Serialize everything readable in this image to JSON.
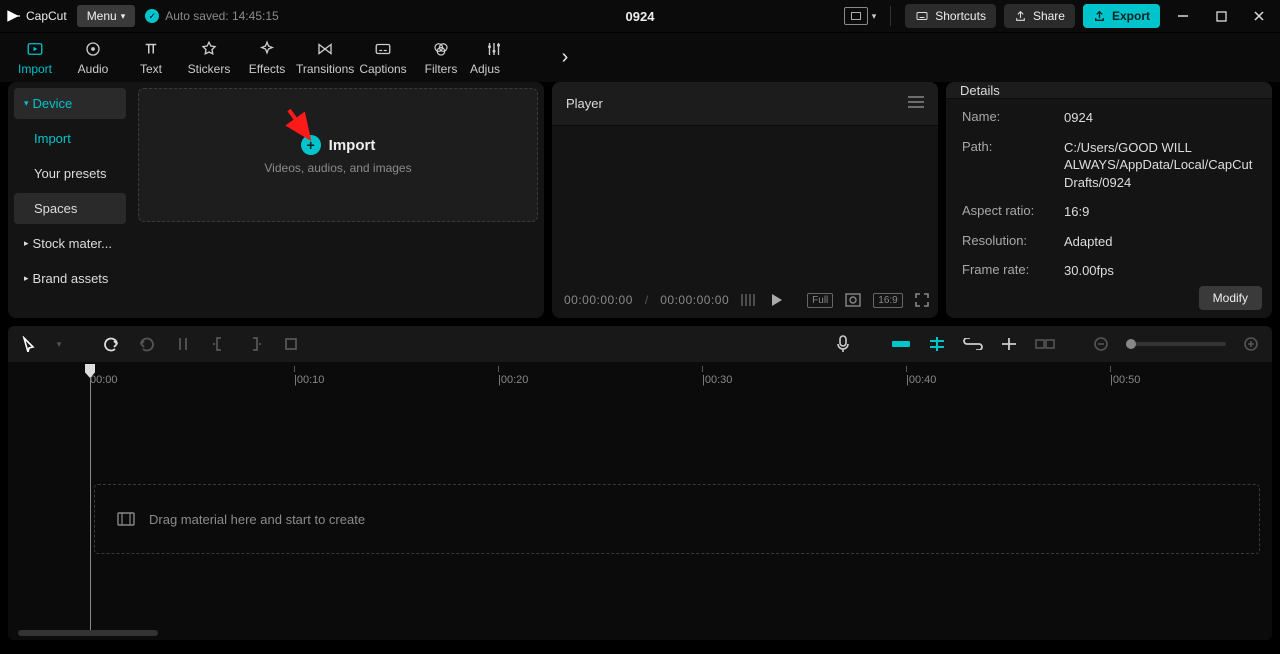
{
  "app": {
    "brand": "CapCut",
    "menu": "Menu",
    "autosave": "Auto saved: 14:45:15",
    "project": "0924"
  },
  "title_actions": {
    "shortcuts": "Shortcuts",
    "share": "Share",
    "export": "Export"
  },
  "tabs": [
    "Import",
    "Audio",
    "Text",
    "Stickers",
    "Effects",
    "Transitions",
    "Captions",
    "Filters",
    "Adjus"
  ],
  "sidebar": {
    "device": "Device",
    "import": "Import",
    "presets": "Your presets",
    "spaces": "Spaces",
    "stock": "Stock mater...",
    "brand": "Brand assets"
  },
  "import_drop": {
    "label": "Import",
    "hint": "Videos, audios, and images"
  },
  "player": {
    "title": "Player",
    "tc_left": "00:00:00:00",
    "tc_right": "00:00:00:00",
    "full": "Full",
    "ratio": "16:9"
  },
  "details": {
    "title": "Details",
    "name_k": "Name:",
    "name_v": "0924",
    "path_k": "Path:",
    "path_v": "C:/Users/GOOD WILL ALWAYS/AppData/Local/CapCut Drafts/0924",
    "aspect_k": "Aspect ratio:",
    "aspect_v": "16:9",
    "res_k": "Resolution:",
    "res_v": "Adapted",
    "fps_k": "Frame rate:",
    "fps_v": "30.00fps",
    "modify": "Modify"
  },
  "ruler": [
    "00:00",
    "00:10",
    "00:20",
    "00:30",
    "00:40",
    "00:50"
  ],
  "timeline": {
    "drop_hint": "Drag material here and start to create"
  }
}
